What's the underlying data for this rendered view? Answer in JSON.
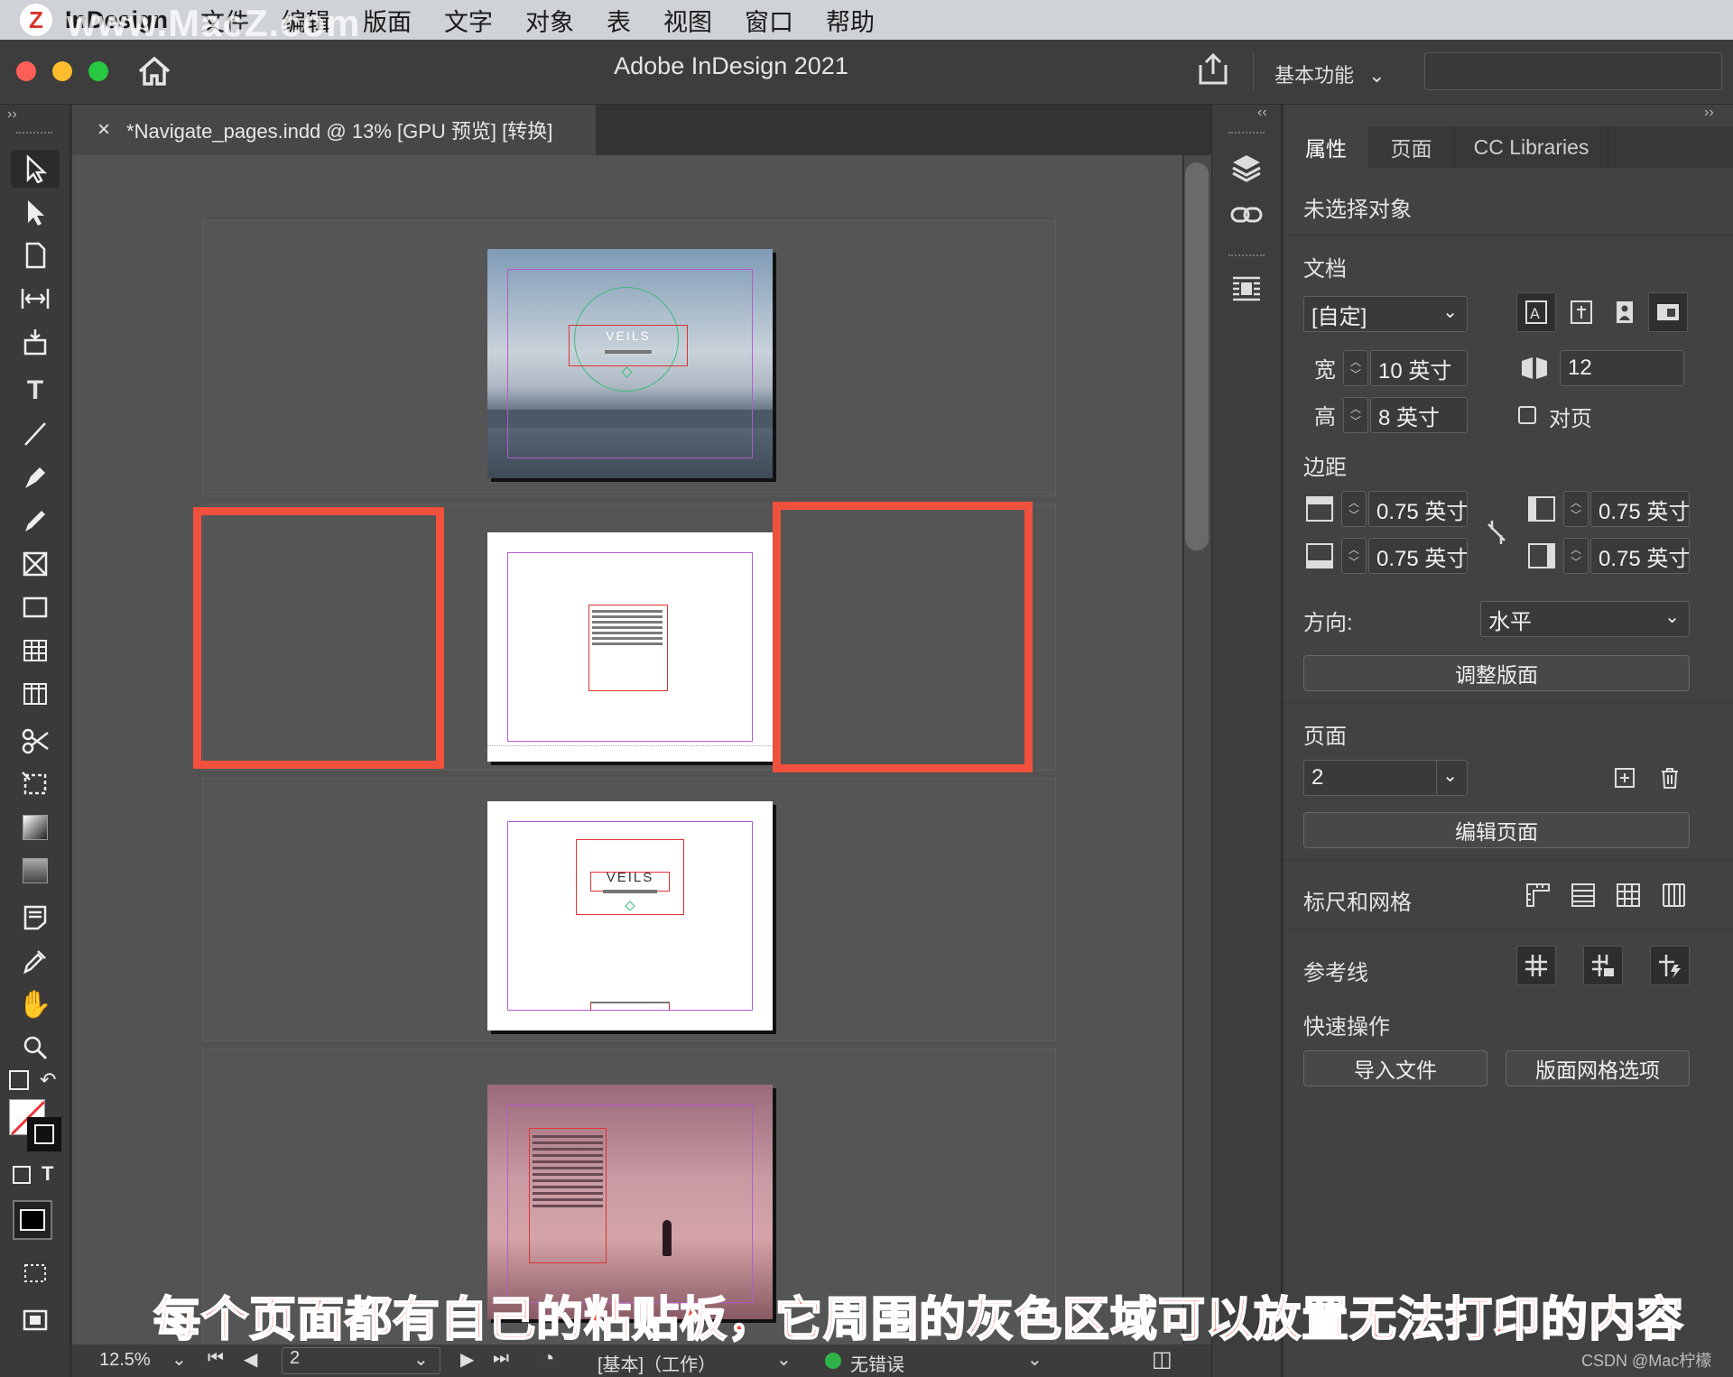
{
  "menubar": {
    "app": "InDesign",
    "items": [
      "文件",
      "编辑",
      "版面",
      "文字",
      "对象",
      "表",
      "视图",
      "窗口",
      "帮助"
    ]
  },
  "watermark": "www.MacZ.com",
  "window": {
    "title": "Adobe InDesign 2021",
    "workspace": "基本功能",
    "search_placeholder": ""
  },
  "doc_tab": {
    "close": "×",
    "title": "*Navigate_pages.indd @ 13% [GPU 预览] [转换]"
  },
  "pages": {
    "cover_label": "VEILS",
    "page3_label": "VEILS"
  },
  "panel": {
    "tabs": [
      "属性",
      "页面",
      "CC Libraries"
    ],
    "no_selection": "未选择对象",
    "document_label": "文档",
    "preset": "[自定]",
    "width_label": "宽",
    "width": "10 英寸",
    "height_label": "高",
    "height": "8 英寸",
    "pages_count": "12",
    "facing_pages": "对页",
    "margins_label": "边距",
    "margin_top": "0.75 英寸",
    "margin_bottom": "0.75 英寸",
    "margin_inside": "0.75 英寸",
    "margin_outside": "0.75 英寸",
    "orientation_label": "方向:",
    "orientation": "水平",
    "adjust_layout": "调整版面",
    "page_label": "页面",
    "page_value": "2",
    "edit_page": "编辑页面",
    "rulers_grids": "标尺和网格",
    "guides": "参考线",
    "quick_actions": "快速操作",
    "import_file": "导入文件",
    "layout_grid_options": "版面网格选项"
  },
  "statusbar": {
    "zoom": "12.5%",
    "page": "2",
    "style": "[基本]（工作）",
    "preflight": "无错误",
    "preflight_color": "#2fb44a"
  },
  "subtitle": "每个页面都有自己的粘贴板，它周围的灰色区域可以放置无法打印的内容",
  "credit": "CSDN @Mac柠檬",
  "colors": {
    "highlight": "#f0503c",
    "margin_guide": "#b45ad0"
  }
}
